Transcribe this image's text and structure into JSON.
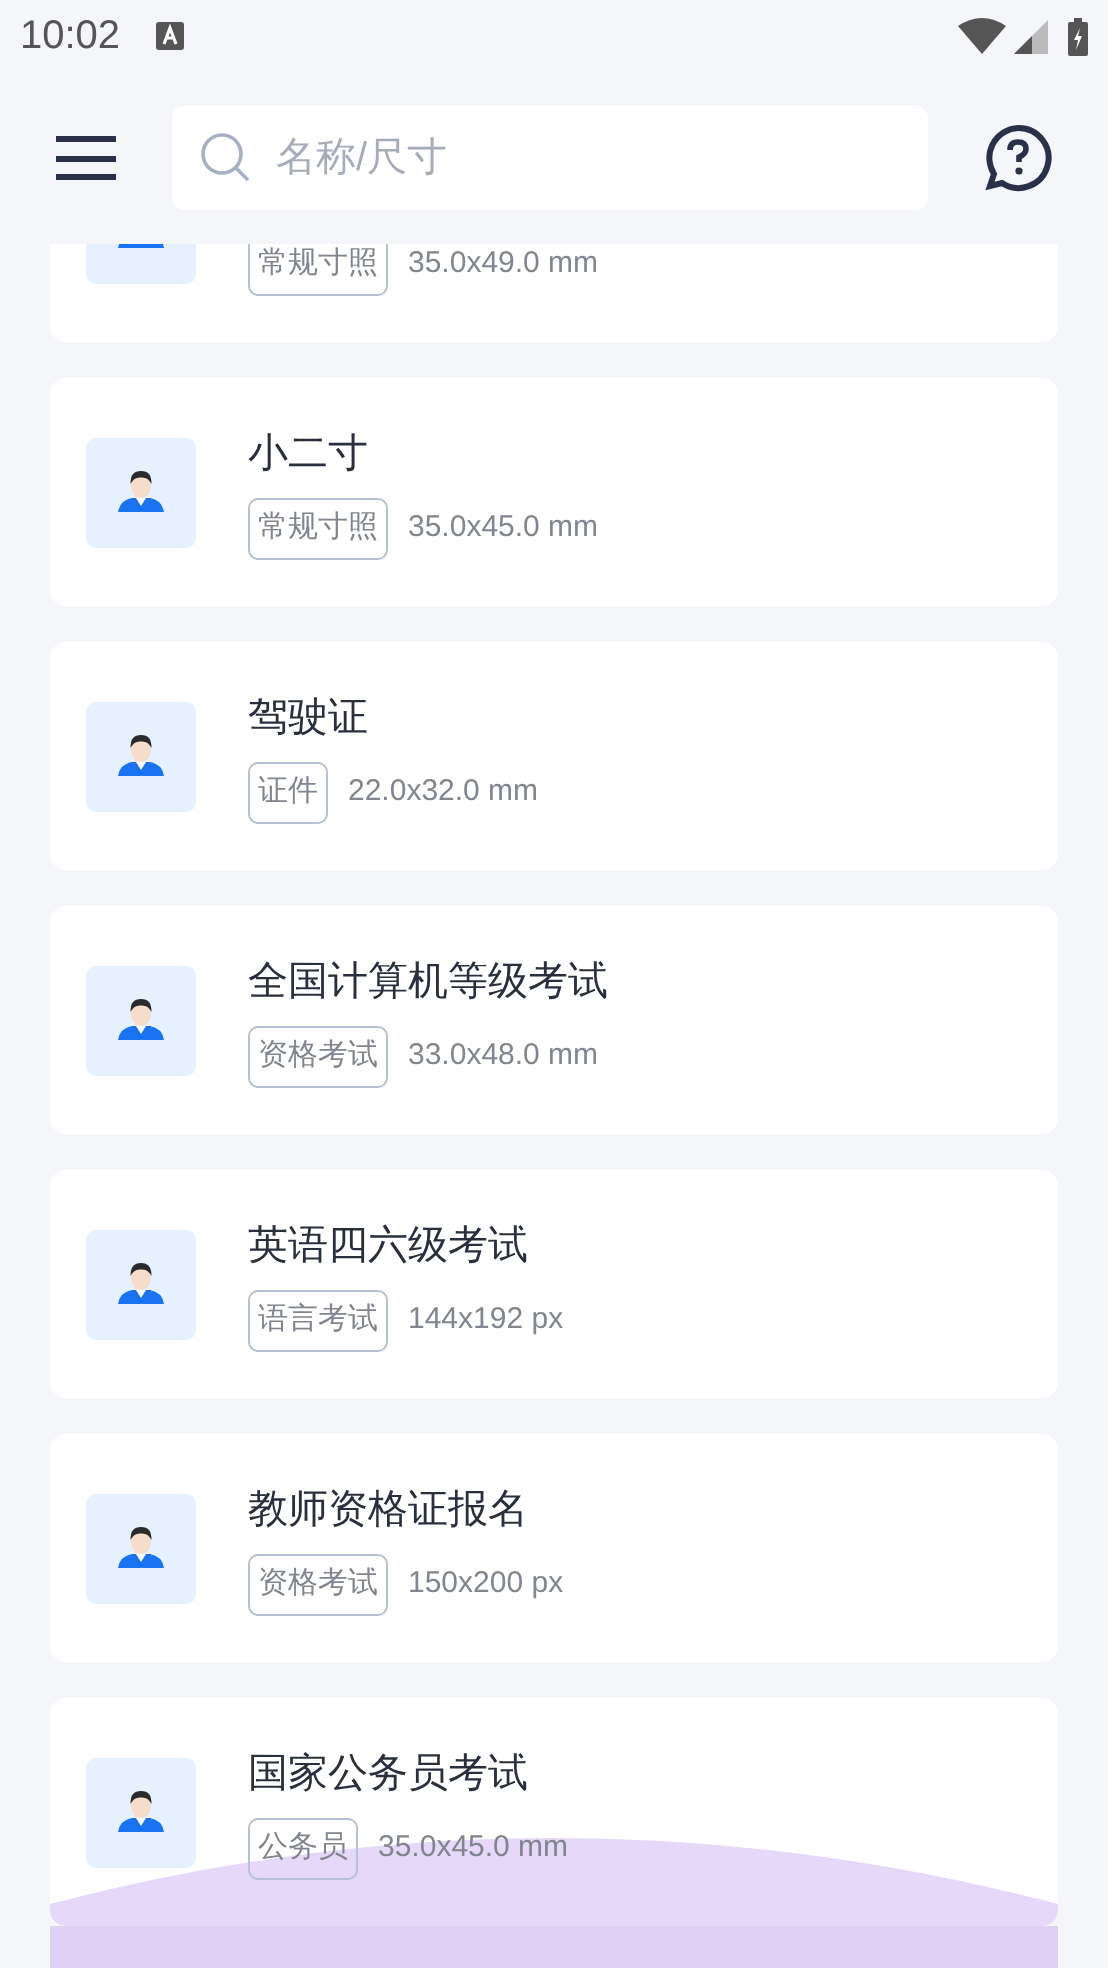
{
  "status_bar": {
    "time": "10:02"
  },
  "search": {
    "placeholder": "名称/尺寸"
  },
  "items": [
    {
      "tag": "常规寸照",
      "size": "35.0x49.0 mm"
    },
    {
      "title": "小二寸",
      "tag": "常规寸照",
      "size": "35.0x45.0 mm"
    },
    {
      "title": "驾驶证",
      "tag": "证件",
      "size": "22.0x32.0 mm"
    },
    {
      "title": "全国计算机等级考试",
      "tag": "资格考试",
      "size": "33.0x48.0 mm"
    },
    {
      "title": "英语四六级考试",
      "tag": "语言考试",
      "size": "144x192 px"
    },
    {
      "title": "教师资格证报名",
      "tag": "资格考试",
      "size": "150x200 px"
    },
    {
      "title": "国家公务员考试",
      "tag": "公务员",
      "size": "35.0x45.0 mm"
    }
  ]
}
